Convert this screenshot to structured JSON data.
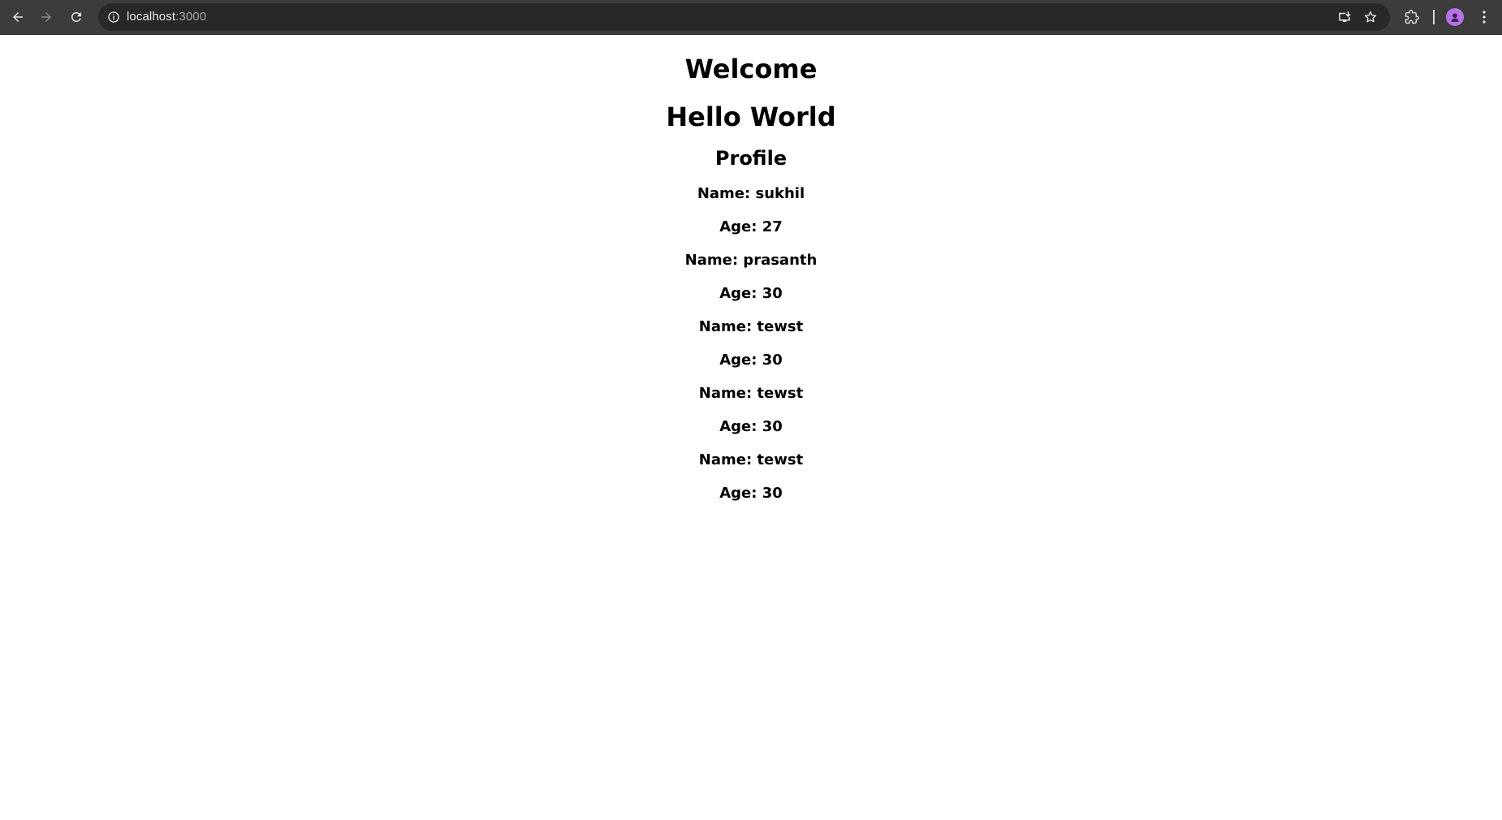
{
  "browser": {
    "url_host": "localhost",
    "url_port": ":3000"
  },
  "page": {
    "welcome": "Welcome",
    "hello": "Hello World",
    "profile_heading": "Profile",
    "people": [
      {
        "name": "Name: sukhil",
        "age": "Age: 27"
      },
      {
        "name": "Name: prasanth",
        "age": "Age: 30"
      },
      {
        "name": "Name: tewst",
        "age": "Age: 30"
      },
      {
        "name": "Name: tewst",
        "age": "Age: 30"
      },
      {
        "name": "Name: tewst",
        "age": "Age: 30"
      }
    ]
  },
  "colors": {
    "toolbar": "#3c3c3c",
    "omnibox": "#282828",
    "avatar": "#b573e6"
  }
}
